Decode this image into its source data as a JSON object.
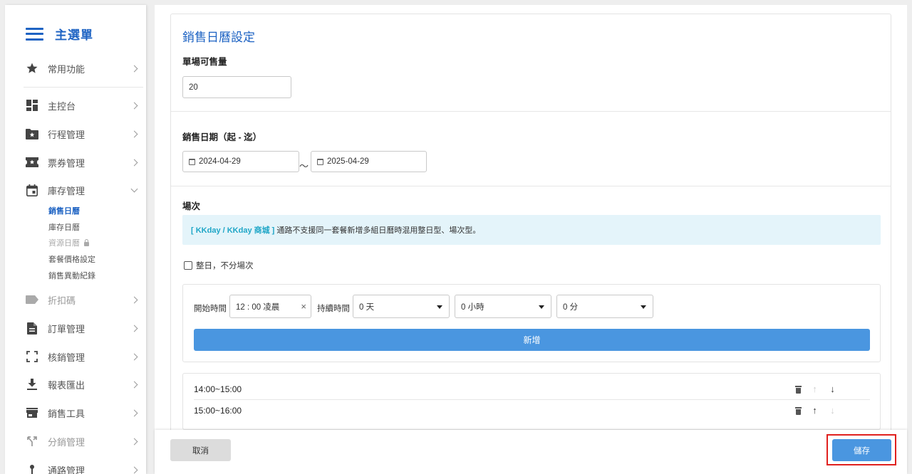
{
  "sidebar": {
    "title": "主選單",
    "items": [
      {
        "label": "常用功能",
        "icon": "star-icon"
      },
      {
        "label": "主控台",
        "icon": "dashboard-icon"
      },
      {
        "label": "行程管理",
        "icon": "folder-star-icon"
      },
      {
        "label": "票券管理",
        "icon": "ticket-icon"
      },
      {
        "label": "庫存管理",
        "icon": "calendar-icon"
      },
      {
        "label": "折扣碼",
        "icon": "label-icon"
      },
      {
        "label": "訂單管理",
        "icon": "document-icon"
      },
      {
        "label": "核銷管理",
        "icon": "scan-icon"
      },
      {
        "label": "報表匯出",
        "icon": "download-icon"
      },
      {
        "label": "銷售工具",
        "icon": "store-icon"
      },
      {
        "label": "分銷管理",
        "icon": "fork-icon"
      },
      {
        "label": "通路管理",
        "icon": "pin-icon"
      }
    ],
    "sub_items": [
      "銷售日曆",
      "庫存日曆",
      "資源日曆",
      "套餐價格設定",
      "銷售異動紀錄"
    ]
  },
  "main": {
    "section_title": "銷售日曆設定",
    "quantity_label": "單場可售量",
    "quantity_value": "20",
    "date_label": "銷售日期（起 - 迄）",
    "date_start": "2024-04-29",
    "date_separator": "～",
    "date_end": "2025-04-29",
    "session_label": "場次",
    "notice_tag": "[ KKday / KKday 商城 ]",
    "notice_text": "通路不支援同一套餐新增多組日曆時混用整日型、場次型。",
    "all_day_label": "整日，不分場次",
    "start_time_label": "開始時間",
    "start_time_value": "12 : 00 凌晨",
    "clear_symbol": "×",
    "duration_label": "持續時間",
    "duration_days": "0 天",
    "duration_hours": "0 小時",
    "duration_minutes": "0 分",
    "add_button": "新增",
    "slots": [
      "14:00~15:00",
      "15:00~16:00"
    ],
    "arrow_up": "↑",
    "arrow_down": "↓"
  },
  "footer": {
    "cancel_label": "取消",
    "save_label": "儲存"
  },
  "colors": {
    "primary": "#1e63c3",
    "button_blue": "#4a96e0",
    "notice_bg": "#e4f4fa",
    "notice_tag": "#1fa6c7",
    "highlight_red": "#e0201e"
  }
}
